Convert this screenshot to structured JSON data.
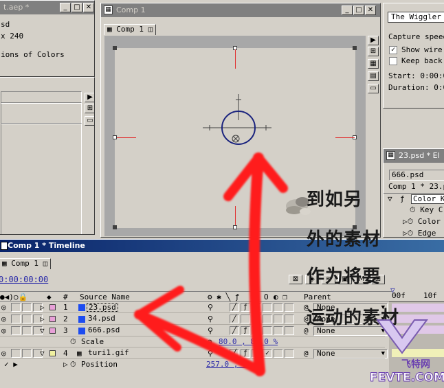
{
  "project_window": {
    "title": "t.aep *",
    "lines": [
      "sd",
      "x 240",
      "ions of Colors"
    ]
  },
  "comp_window": {
    "title": "Comp 1",
    "tab": "Comp 1"
  },
  "wiggler_panel": {
    "tab": "The Wiggler",
    "capture_speed": "Capture speed",
    "show_wireframe": "Show wire",
    "keep_background": "Keep back",
    "start": "Start: 0:00:0",
    "duration": "Duration: 0:0",
    "show_checked": true,
    "keep_checked": false
  },
  "effects_panel": {
    "title": "23.psd * El",
    "layer_field": "666.psd",
    "breadcrumb": "Comp 1 * 23.p",
    "effect_name": "Color K",
    "props": [
      "Key C",
      "Color",
      "Edge"
    ]
  },
  "timeline": {
    "title": "Comp 1 * Timeline",
    "tab": "Comp 1",
    "timecode": "0:00:00:00",
    "col_number": "#",
    "col_source": "Source Name",
    "col_parent": "Parent",
    "ruler_0": "00f",
    "ruler_10": "10f",
    "switch_headers": [
      "M",
      "O"
    ],
    "layers": [
      {
        "num": "1",
        "name": "23.psd",
        "parent": "None",
        "chip": "#e8a0d8"
      },
      {
        "num": "2",
        "name": "34.psd",
        "parent": "None",
        "chip": "#e8a0d8"
      },
      {
        "num": "3",
        "name": "666.psd",
        "parent": "None",
        "chip": "#e8a0d8"
      },
      {
        "num": "4",
        "name": "turi1.gif",
        "parent": "None",
        "chip": "#f0f0a0"
      }
    ],
    "scale_label": "Scale",
    "scale_value": "80.0 , 80.0 %",
    "position_label": "Position",
    "position_value": "257.0 , 3"
  },
  "annotation": {
    "lines": [
      "到如另",
      "外的素材",
      "作为将要",
      "运动的素材"
    ],
    "arrow_color": "#ff1a1a"
  },
  "watermark": {
    "cn": "飞特网",
    "en": "FEVTE.COM"
  }
}
